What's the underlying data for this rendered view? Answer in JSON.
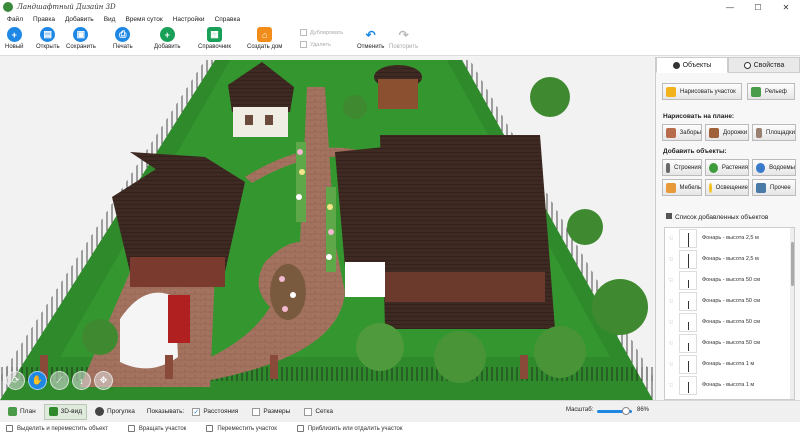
{
  "app": {
    "title": "Ландшафтный Дизайн 3D"
  },
  "window_controls": {
    "minimize": "—",
    "maximize": "☐",
    "close": "✕"
  },
  "menu": [
    "Файл",
    "Правка",
    "Добавить",
    "Вид",
    "Время суток",
    "Настройки",
    "Справка"
  ],
  "toolbar": {
    "new": "Новый",
    "open": "Открыть",
    "save": "Сохранить",
    "print": "Печать",
    "add": "Добавить",
    "reference": "Справочник",
    "create_house": "Создать дом",
    "duplicate": "Дублировать",
    "delete": "Удалить",
    "undo": "Отменить",
    "redo": "Повторить"
  },
  "colors": {
    "accent": "#1f88e5",
    "grass": "#2e8a2a",
    "roof": "#3a2a22",
    "path": "#a77866",
    "save_orange": "#f08a1c",
    "create_house_orange": "#f28c1a"
  },
  "panel": {
    "tab_objects": "Объекты",
    "tab_properties": "Свойства",
    "draw_plot": "Нарисовать участок",
    "relief": "Рельеф",
    "draw_on_plan_title": "Нарисовать на плане:",
    "fences": "Заборы",
    "paths": "Дорожки",
    "platforms": "Площадки",
    "add_objects_title": "Добавить объекты:",
    "buildings": "Строения",
    "plants": "Растения",
    "ponds": "Водоемы",
    "furniture": "Мебель",
    "lighting": "Освещение",
    "other": "Прочее",
    "list_title": "Список добавленных объектов",
    "items": [
      "Фонарь - высота 2,5 м",
      "Фонарь - высота 2,5 м",
      "Фонарь - высота 50 см",
      "Фонарь - высота 50 см",
      "Фонарь - высота 50 см",
      "Фонарь - высота 50 см",
      "Фонарь - высота 1 м",
      "Фонарь - высота 1 м"
    ]
  },
  "bottom": {
    "plan": "План",
    "view3d": "3D-вид",
    "walk": "Прогулка",
    "show": "Показывать:",
    "distances": "Расстояния",
    "dimensions": "Размеры",
    "grid": "Сетка",
    "distances_checked": true,
    "dimensions_checked": false,
    "grid_checked": false,
    "scale_label": "Масштаб:",
    "scale_value": "86%",
    "scale_fraction": 0.86
  },
  "status": {
    "select_move": "Выделить и переместить объект",
    "rotate": "Вращать участок",
    "move": "Переместить участок",
    "zoom": "Приблизить или отдалить участок"
  }
}
